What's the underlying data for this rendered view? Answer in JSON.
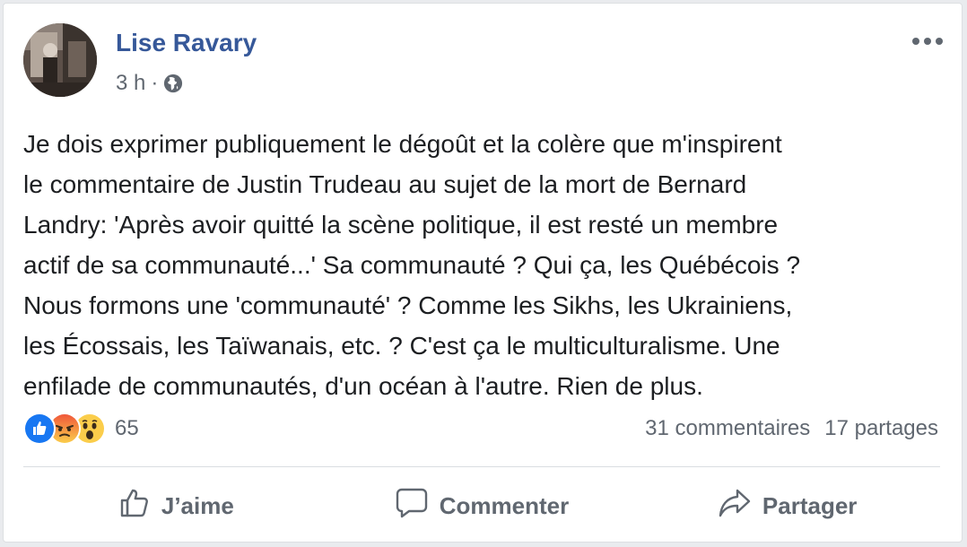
{
  "post": {
    "author": "Lise Ravary",
    "time": "3 h",
    "separator": "·",
    "privacy_icon": "globe-icon",
    "body": "Je dois exprimer publiquement le dégoût et la colère que m'inspirent\nle commentaire de Justin Trudeau au sujet de la mort de Bernard\nLandry: 'Après avoir quitté la scène politique, il est resté un membre\nactif de sa communauté...' Sa communauté ? Qui ça, les Québécois ?\nNous formons une 'communauté' ? Comme les Sikhs, les Ukrainiens,\nles Écossais, les Taïwanais, etc. ? C'est ça le multiculturalisme. Une\nenfilade de communautés, d'un océan à l'autre. Rien de plus."
  },
  "reactions": {
    "icons": [
      "like-reaction-icon",
      "angry-reaction-icon",
      "wow-reaction-icon"
    ],
    "count": "65"
  },
  "stats": {
    "comments": "31 commentaires",
    "shares": "17 partages"
  },
  "actions": {
    "like": "J’aime",
    "comment": "Commenter",
    "share": "Partager"
  },
  "colors": {
    "author_link": "#365899",
    "secondary_text": "#606770",
    "like_blue": "#1877f2",
    "angry_orange": "#f0573a",
    "wow_yellow": "#fbcd4b"
  }
}
